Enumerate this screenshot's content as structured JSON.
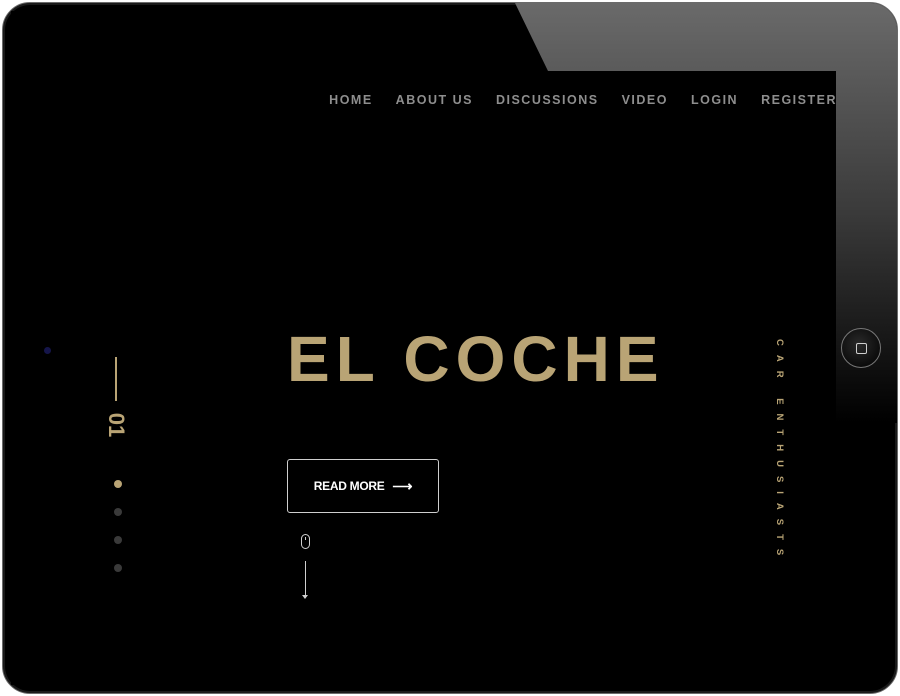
{
  "nav": {
    "items": [
      {
        "label": "HOME"
      },
      {
        "label": "ABOUT US"
      },
      {
        "label": "DISCUSSIONS"
      },
      {
        "label": "VIDEO"
      },
      {
        "label": "LOGIN"
      },
      {
        "label": "REGISTER"
      }
    ]
  },
  "hero": {
    "title": "EL COCHE",
    "read_more_label": "READ MORE",
    "read_more_arrow": "⟶"
  },
  "slider": {
    "current_number": "01",
    "total_dots": 4,
    "active_index": 0
  },
  "side_tag": "CAR ENTHUSIASTS",
  "colors": {
    "accent_gold": "#b9a475",
    "background": "#000000",
    "nav_text": "#8e8e8e"
  },
  "icons": {
    "mouse": "mouse-scroll-icon",
    "arrow": "arrow-right-icon",
    "home": "home-button-icon"
  }
}
